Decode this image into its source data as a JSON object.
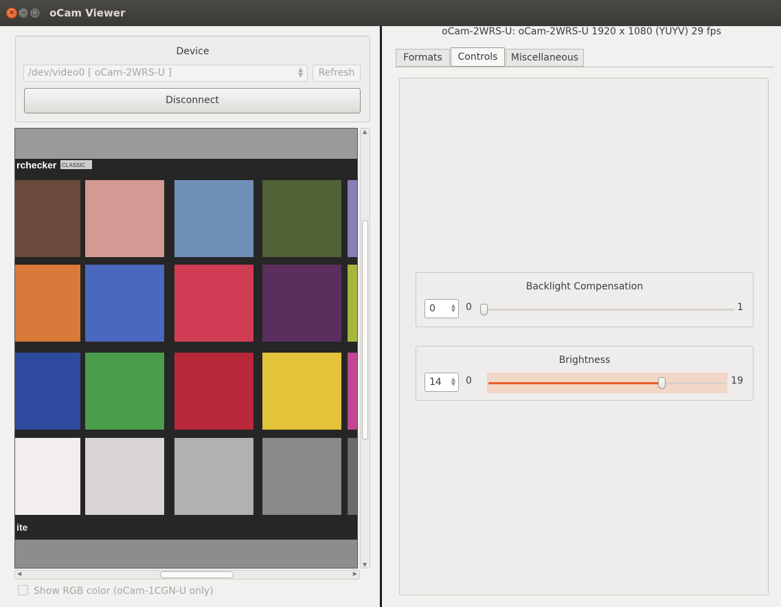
{
  "window": {
    "title": "oCam Viewer"
  },
  "device": {
    "group_label": "Device",
    "selected": "/dev/video0 [ oCam-2WRS-U ]",
    "refresh_label": "Refresh",
    "disconnect_label": "Disconnect"
  },
  "preview": {
    "brand_text": "rchecker",
    "brand_badge": "CLASSIC",
    "bottom_text": "ite",
    "swatch_colors": [
      [
        "#6b4a3c",
        "#d39a94",
        "#6f8fb8",
        "#4f6236",
        "#8a7fb6"
      ],
      [
        "#d9793a",
        "#4b68bf",
        "#d13c55",
        "#5a2f5e",
        "#a8b63d"
      ],
      [
        "#2e4a9e",
        "#4a9d4b",
        "#b8273a",
        "#e2c33a",
        "#c14791"
      ],
      [
        "#f2eeee",
        "#d8d4d6",
        "#b3b0b2",
        "#8a8889",
        "#6a6a6a"
      ]
    ]
  },
  "show_rgb": {
    "label": "Show RGB color (oCam-1CGN-U only)",
    "checked": false
  },
  "status": {
    "info": "oCam-2WRS-U: oCam-2WRS-U  1920 x 1080 (YUYV)  29 fps"
  },
  "tabs": [
    {
      "label": "Formats",
      "active": false
    },
    {
      "label": "Controls",
      "active": true
    },
    {
      "label": "Miscellaneous",
      "active": false
    }
  ],
  "controls": {
    "backlight": {
      "label": "Backlight Compensation",
      "value": "0",
      "min": "0",
      "max": "1",
      "level": 0
    },
    "brightness": {
      "label": "Brightness",
      "value": "14",
      "min": "0",
      "max": "19",
      "level": 0.737
    }
  },
  "colors": {
    "accent": "#e35b25",
    "titlebar": "#3c3b37"
  }
}
